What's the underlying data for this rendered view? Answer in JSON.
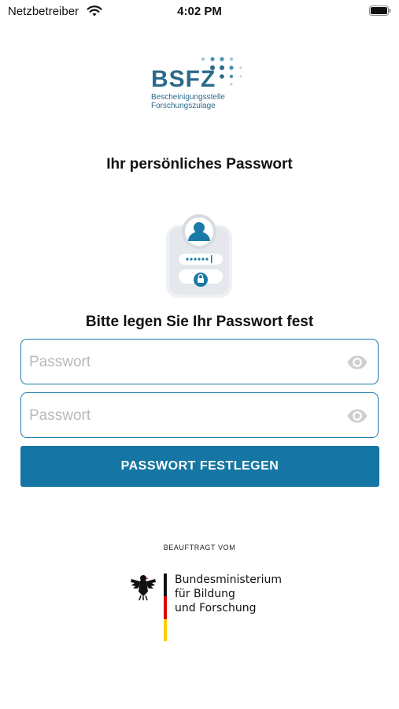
{
  "status_bar": {
    "carrier": "Netzbetreiber",
    "time": "4:02 PM",
    "icons": [
      "wifi-icon",
      "battery-icon"
    ]
  },
  "logo": {
    "brand": "BSFZ",
    "subtitle_line1": "Bescheinigungsstelle",
    "subtitle_line2": "Forschungszulage",
    "brand_color": "#2b6a8a"
  },
  "page": {
    "title": "Ihr persönliches Passwort",
    "subtitle": "Bitte legen Sie Ihr Passwort fest"
  },
  "form": {
    "password_placeholder": "Passwort",
    "password_value": "",
    "confirm_placeholder": "Passwort",
    "confirm_value": "",
    "submit_label": "PASSWORT FESTLEGEN",
    "accent_color": "#1676a3"
  },
  "footer": {
    "label": "BEAUFTRAGT VOM",
    "ministry_line1": "Bundesministerium",
    "ministry_line2": "für Bildung",
    "ministry_line3": "und Forschung"
  }
}
